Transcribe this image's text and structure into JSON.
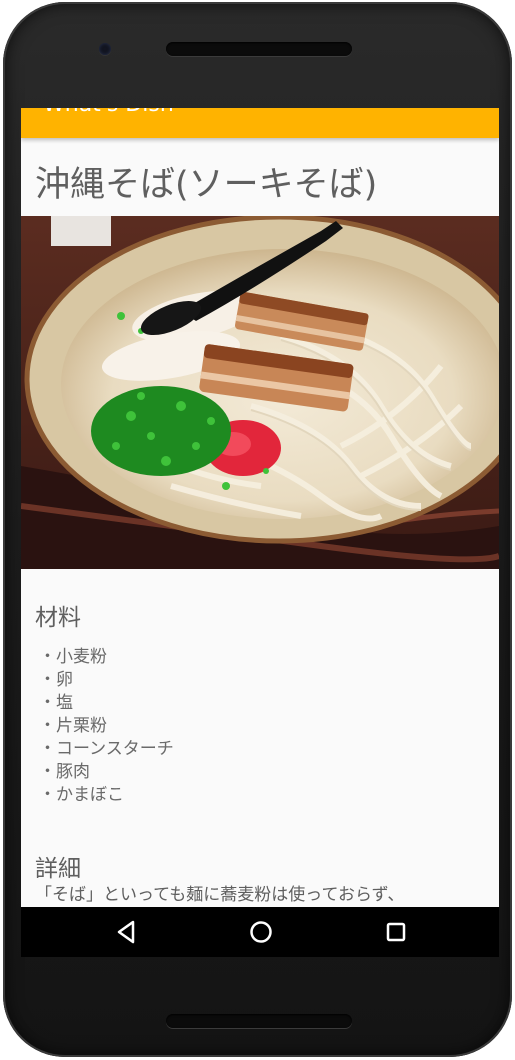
{
  "app": {
    "title": "What's Dish",
    "accent_color": "#ffb300"
  },
  "dish": {
    "title": "沖縄そば(ソーキそば)",
    "image_description_icon": "okinawa-soba-photo"
  },
  "ingredients": {
    "heading": "材料",
    "items": [
      "小麦粉",
      "卵",
      "塩",
      "片栗粉",
      "コーンスターチ",
      "豚肉",
      "かまぼこ"
    ]
  },
  "details": {
    "heading": "詳細",
    "text": "「そば」といっても麺に蕎麦粉は使っておらず、"
  },
  "nav": {
    "back_icon": "back-triangle-icon",
    "home_icon": "home-circle-icon",
    "recent_icon": "recent-apps-square-icon"
  }
}
